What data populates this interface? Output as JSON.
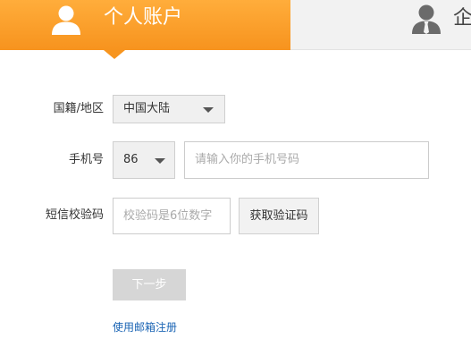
{
  "tabs": {
    "personal": {
      "label": "个人账户",
      "icon": "user-icon"
    },
    "enterprise": {
      "label": "企",
      "icon": "business-user-icon"
    }
  },
  "form": {
    "nationality": {
      "label": "国籍/地区",
      "value": "中国大陆"
    },
    "phone": {
      "label": "手机号",
      "country_code": "86",
      "placeholder": "请输入你的手机号码"
    },
    "sms_code": {
      "label": "短信校验码",
      "placeholder": "校验码是6位数字",
      "button": "获取验证码"
    },
    "next_button": "下一步",
    "email_register_link": "使用邮箱注册"
  },
  "colors": {
    "accent": "#f7931e",
    "link": "#1a64b4",
    "disabled_button": "#d6d6d6"
  }
}
